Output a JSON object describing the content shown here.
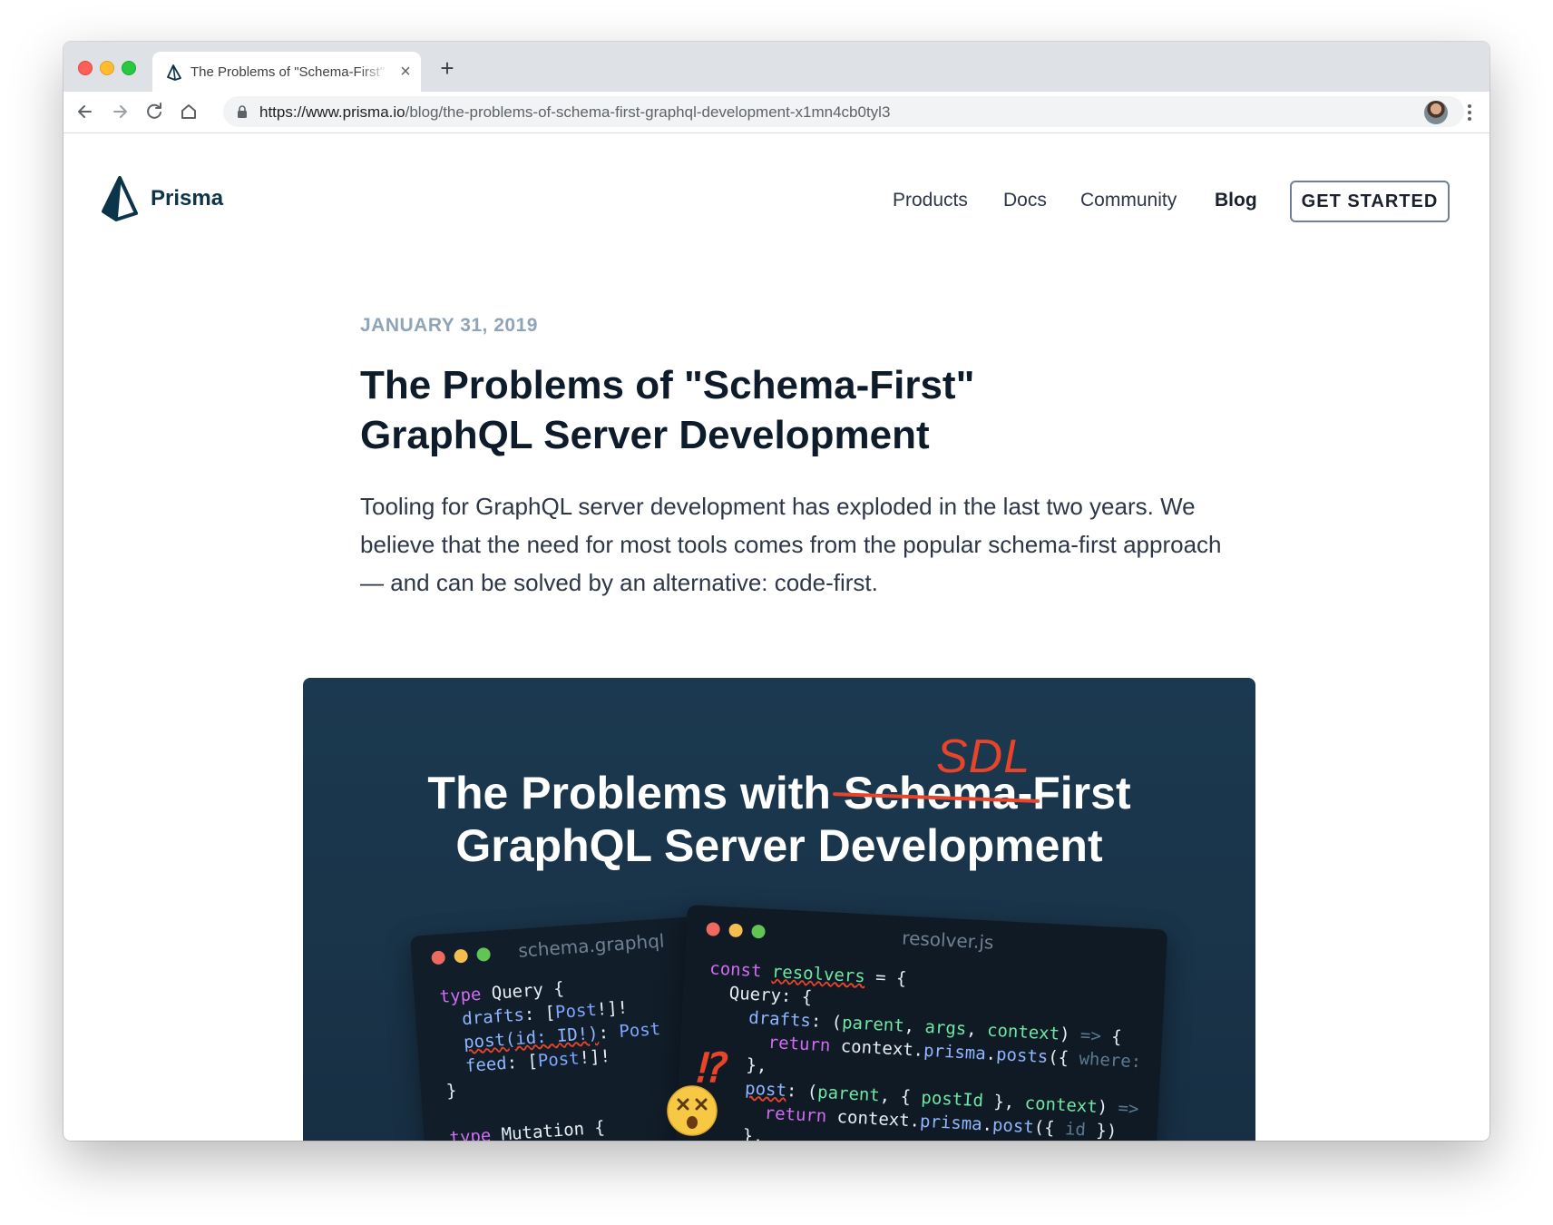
{
  "browser": {
    "tab_title": "The Problems of \"Schema-First\" GraphQL Server Development",
    "url_host": "https://www.prisma.io",
    "url_path": "/blog/the-problems-of-schema-first-graphql-development-x1mn4cb0tyl3"
  },
  "site": {
    "brand": "Prisma",
    "nav": [
      "Products",
      "Docs",
      "Community",
      "Blog"
    ],
    "active_nav": "Blog",
    "cta": "GET STARTED"
  },
  "article": {
    "date": "JANUARY 31, 2019",
    "title": "The Problems of \"Schema-First\" GraphQL Server Development",
    "excerpt": "Tooling for GraphQL server development has exploded in the last two years. We believe that the need for most tools comes from the popular schema-first approach — and can be solved by an alternative: code-first."
  },
  "hero": {
    "line1_prefix": "The Problems with ",
    "line1_struck": "Schema",
    "line1_suffix": "-First",
    "line2": "GraphQL Server Development",
    "annotation": "SDL",
    "left_file": "schema.graphql",
    "right_file": "resolver.js",
    "interrobang": "⁉"
  },
  "colors": {
    "hero_bg": "#1b3950",
    "accent_red": "#e8442a",
    "brand": "#0c344b"
  }
}
